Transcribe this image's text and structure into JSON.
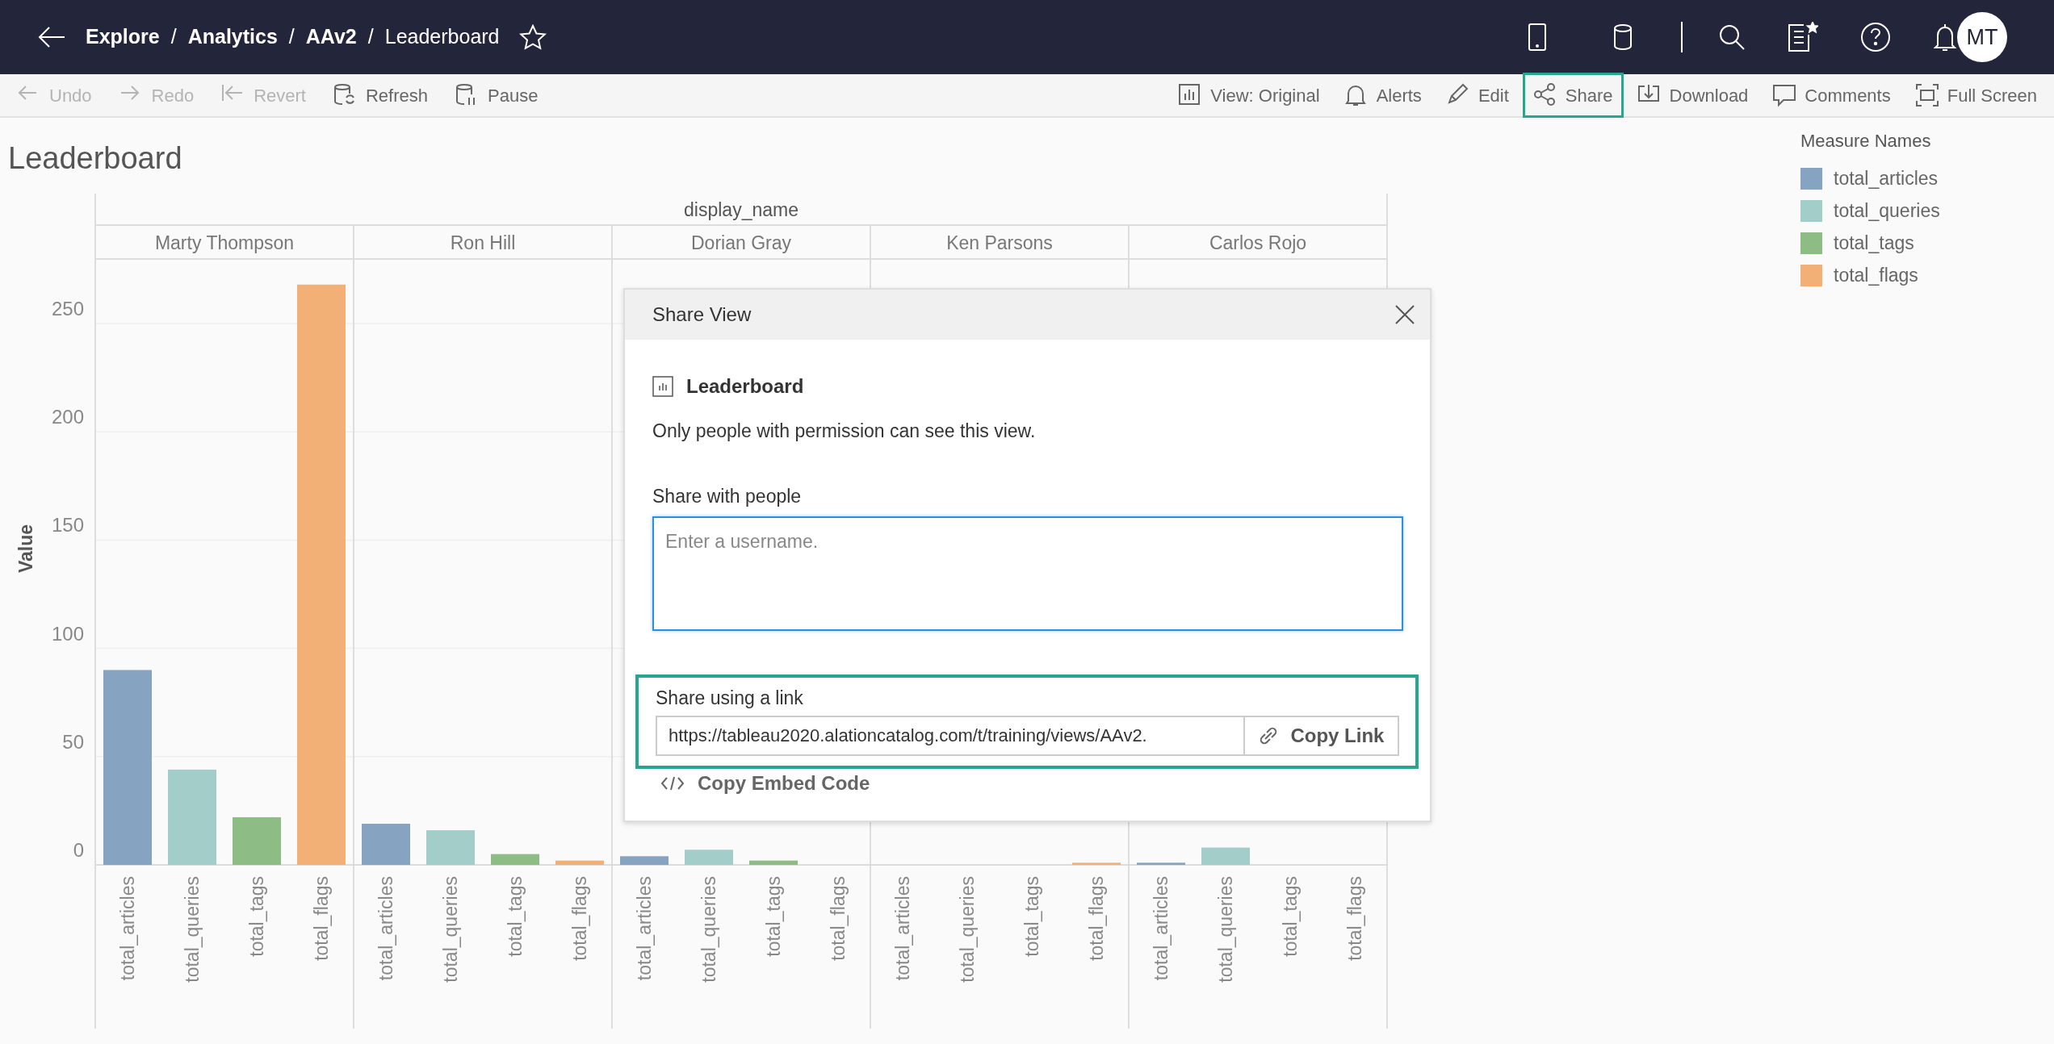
{
  "topbar": {
    "separator": "/",
    "breadcrumb": [
      {
        "label": "Explore",
        "current": false
      },
      {
        "label": "Analytics",
        "current": false
      },
      {
        "label": "AAv2",
        "current": false
      },
      {
        "label": "Leaderboard",
        "current": true
      }
    ],
    "avatar": "MT"
  },
  "toolbar": {
    "left": [
      {
        "kind": "undo",
        "label": "Undo",
        "disabled": true,
        "highlighted": false
      },
      {
        "kind": "redo",
        "label": "Redo",
        "disabled": true,
        "highlighted": false
      },
      {
        "kind": "revert",
        "label": "Revert",
        "disabled": true,
        "highlighted": false
      },
      {
        "kind": "refresh",
        "label": "Refresh",
        "disabled": false,
        "highlighted": false
      },
      {
        "kind": "pause",
        "label": "Pause",
        "disabled": false,
        "highlighted": false
      }
    ],
    "right": [
      {
        "kind": "view",
        "label": "View: Original",
        "disabled": false,
        "highlighted": false
      },
      {
        "kind": "alerts",
        "label": "Alerts",
        "disabled": false,
        "highlighted": false
      },
      {
        "kind": "edit",
        "label": "Edit",
        "disabled": false,
        "highlighted": false
      },
      {
        "kind": "share",
        "label": "Share",
        "disabled": false,
        "highlighted": true
      },
      {
        "kind": "download",
        "label": "Download",
        "disabled": false,
        "highlighted": false
      },
      {
        "kind": "comments",
        "label": "Comments",
        "disabled": false,
        "highlighted": false
      },
      {
        "kind": "fullscreen",
        "label": "Full Screen",
        "disabled": false,
        "highlighted": false
      }
    ]
  },
  "sheet_title": "Leaderboard",
  "chart": {
    "chart_data": {
      "type": "bar",
      "xlabel": "display_name",
      "ylabel": "Value",
      "categories": [
        "Marty Thompson",
        "Ron Hill",
        "Dorian Gray",
        "Ken Parsons",
        "Carlos Rojo"
      ],
      "series": [
        {
          "name": "total_articles",
          "color": "#86a4c2",
          "values": [
            90,
            19,
            4,
            0,
            1
          ]
        },
        {
          "name": "total_queries",
          "color": "#a2cdc8",
          "values": [
            44,
            16,
            7,
            0,
            8
          ]
        },
        {
          "name": "total_tags",
          "color": "#8dbd84",
          "values": [
            22,
            5,
            2,
            0,
            0
          ]
        },
        {
          "name": "total_flags",
          "color": "#f2b077",
          "values": [
            268,
            2,
            0,
            1,
            0
          ]
        }
      ],
      "ylim": [
        0,
        310
      ],
      "yticks": [
        0,
        50,
        100,
        150,
        200,
        250
      ],
      "grid": true
    }
  },
  "legend": {
    "title": "Measure Names",
    "items": [
      {
        "label": "total_articles",
        "color": "#86a4c2"
      },
      {
        "label": "total_queries",
        "color": "#a2cdc8"
      },
      {
        "label": "total_tags",
        "color": "#8dbd84"
      },
      {
        "label": "total_flags",
        "color": "#f2b077"
      }
    ]
  },
  "dialog": {
    "title": "Share View",
    "view_name": "Leaderboard",
    "notice": "Only people with permission can see this view.",
    "people_label": "Share with people",
    "people_placeholder": "Enter a username.",
    "link_label": "Share using a link",
    "link_value": "https://tableau2020.alationcatalog.com/t/training/views/AAv2.",
    "copy_link": "Copy Link",
    "link_highlighted": true,
    "embed": "Copy Embed Code"
  }
}
